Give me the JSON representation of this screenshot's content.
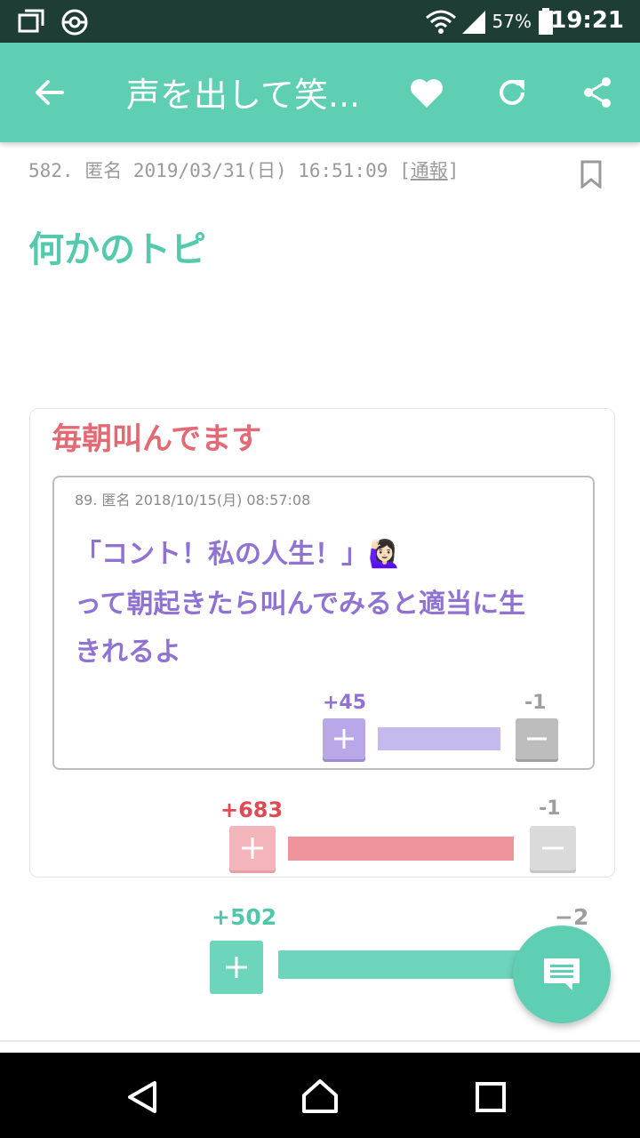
{
  "status_bar": {
    "battery_percent": "57%",
    "time": "19:21"
  },
  "app_bar": {
    "title": "声を出して笑..."
  },
  "post": {
    "number": "582.",
    "author": "匿名",
    "datetime": "2019/03/31(日) 16:51:09",
    "report_open": "[",
    "report_label": "通報",
    "report_close": "]"
  },
  "topic": {
    "title": "何かのトピ"
  },
  "quoted_topic": {
    "title": "毎朝叫んでます",
    "comment": {
      "meta": "89. 匿名 2018/10/15(月) 08:57:08",
      "lines": [
        "「コント！私の人生！」🙋🏻‍♀️",
        "って朝起きたら叫んでみると適当に生",
        "きれるよ"
      ],
      "plus": "+45",
      "minus": "-1"
    },
    "plus": "+683",
    "minus": "-1"
  },
  "post_votes": {
    "plus": "+502",
    "minus": "−2"
  },
  "colors": {
    "accent": "#5fcfb3",
    "heading_red": "#e36a74",
    "quote_purple": "#8f72d1",
    "status_bar": "#1e3d35"
  },
  "icons": [
    "back-arrow-icon",
    "heart-icon",
    "refresh-icon",
    "share-icon",
    "bookmark-icon",
    "comment-icon",
    "nav-back-icon",
    "nav-home-icon",
    "nav-recents-icon"
  ]
}
